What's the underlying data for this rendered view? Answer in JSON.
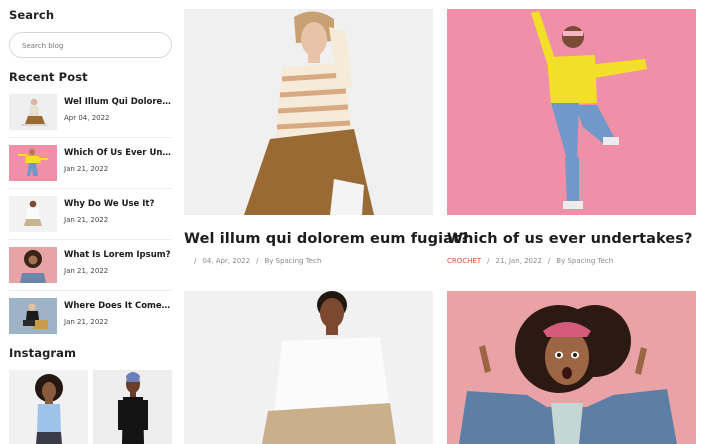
{
  "sidebar": {
    "search": {
      "title": "Search",
      "placeholder": "Search blog"
    },
    "recent": {
      "title": "Recent Post",
      "posts": [
        {
          "title": "Wel Illum Qui Dolorem ...",
          "date": "Apr 04, 2022"
        },
        {
          "title": "Which Of Us Ever Unde...",
          "date": "Jan 21, 2022"
        },
        {
          "title": "Why Do We Use It?",
          "date": "Jan 21, 2022"
        },
        {
          "title": "What Is Lorem Ipsum?",
          "date": "Jan 21, 2022"
        },
        {
          "title": "Where Does It Come Fr...",
          "date": "Jan 21, 2022"
        }
      ]
    },
    "instagram": {
      "title": "Instagram"
    }
  },
  "posts": [
    {
      "title": "Wel illum qui dolorem eum fugiat?",
      "category": "",
      "date": "04, Apr, 2022",
      "author": "By Spacing Tech"
    },
    {
      "title": "Which of us ever undertakes?",
      "category": "CROCHET",
      "date": "21, Jan, 2022",
      "author": "By Spacing Tech"
    },
    {
      "title": "",
      "category": "",
      "date": "",
      "author": ""
    },
    {
      "title": "",
      "category": "",
      "date": "",
      "author": ""
    }
  ],
  "colors": {
    "accent": "#e04a2f",
    "pink_bg": "#f08fa8",
    "card_bg": "#f1f1f1"
  }
}
